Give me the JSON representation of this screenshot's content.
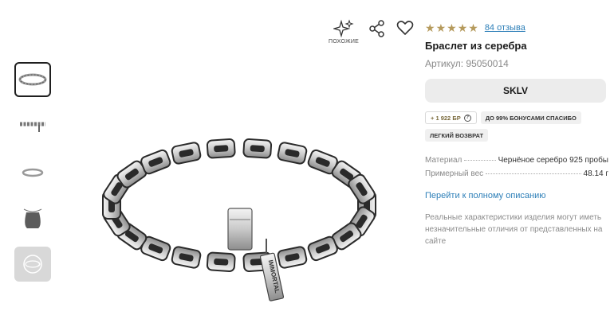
{
  "rating": {
    "stars": 5,
    "reviews_text": "84 отзыва",
    "star_color": "#b59a5c"
  },
  "product": {
    "title": "Браслет из серебра",
    "article": "Артикул: 95050014",
    "brand_button": "SKLV"
  },
  "actions": {
    "similar_label": "ПОХОЖИЕ"
  },
  "badges": {
    "bonus": "+ 1 922 БР",
    "up_to_bonus": "ДО 99% БОНУСАМИ СПАСИБО",
    "easy_return": "ЛЕГКИЙ ВОЗВРАТ"
  },
  "specs": [
    {
      "key": "Материал",
      "value": "Чернёное серебро 925 пробы"
    },
    {
      "key": "Примерный вес",
      "value": "48.14 г"
    }
  ],
  "full_description_link": "Перейти к полному описанию",
  "disclaimer": "Реальные характеристики изделия могут иметь незначительные отличия от представленных на сайте",
  "bracelet_engraving": "IMMORTAL",
  "colors": {
    "link": "#2d7fb8",
    "accent_gold": "#b59a5c"
  }
}
